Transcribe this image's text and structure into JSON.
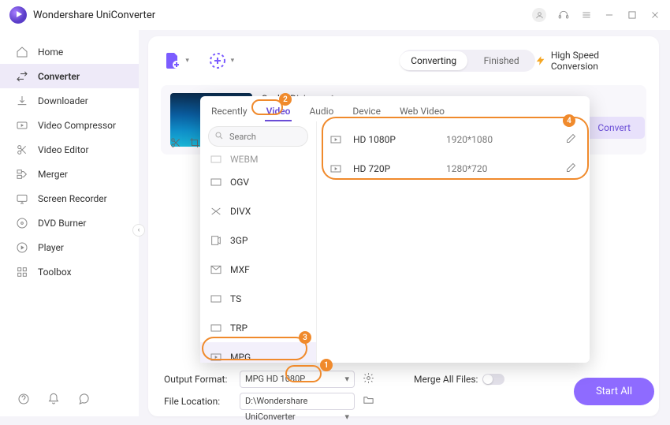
{
  "app": {
    "title": "Wondershare UniConverter"
  },
  "sidebar": {
    "items": [
      {
        "label": "Home"
      },
      {
        "label": "Converter"
      },
      {
        "label": "Downloader"
      },
      {
        "label": "Video Compressor"
      },
      {
        "label": "Video Editor"
      },
      {
        "label": "Merger"
      },
      {
        "label": "Screen Recorder"
      },
      {
        "label": "DVD Burner"
      },
      {
        "label": "Player"
      },
      {
        "label": "Toolbox"
      }
    ]
  },
  "segment": {
    "converting": "Converting",
    "finished": "Finished"
  },
  "highspeed": "High Speed Conversion",
  "file": {
    "title": "Scuba Diving -"
  },
  "convert_label": "Convert",
  "popup": {
    "tabs": [
      "Recently",
      "Video",
      "Audio",
      "Device",
      "Web Video"
    ],
    "search_placeholder": "Search",
    "formats": [
      "WEBM",
      "OGV",
      "DIVX",
      "3GP",
      "MXF",
      "TS",
      "TRP",
      "MPG"
    ],
    "resolutions": [
      {
        "name": "HD 1080P",
        "dim": "1920*1080"
      },
      {
        "name": "HD 720P",
        "dim": "1280*720"
      }
    ]
  },
  "bottom": {
    "output_label": "Output Format:",
    "output_value": "MPG HD 1080P",
    "location_label": "File Location:",
    "location_value": "D:\\Wondershare UniConverter",
    "merge_label": "Merge All Files:",
    "startall": "Start All"
  },
  "badges": {
    "b1": "1",
    "b2": "2",
    "b3": "3",
    "b4": "4"
  }
}
